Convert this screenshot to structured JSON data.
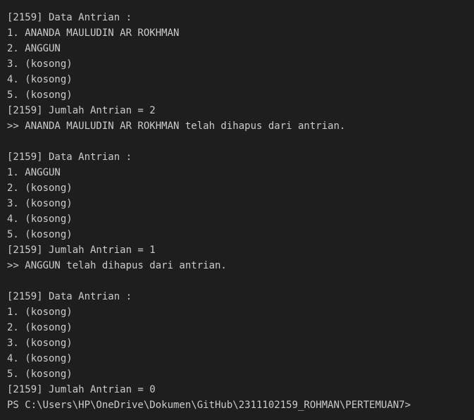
{
  "terminal": {
    "lines": [
      "[2159] Data Antrian :",
      "1. ANANDA MAULUDIN AR ROKHMAN",
      "2. ANGGUN",
      "3. (kosong)",
      "4. (kosong)",
      "5. (kosong)",
      "[2159] Jumlah Antrian = 2",
      ">> ANANDA MAULUDIN AR ROKHMAN telah dihapus dari antrian.",
      "",
      "[2159] Data Antrian :",
      "1. ANGGUN",
      "2. (kosong)",
      "3. (kosong)",
      "4. (kosong)",
      "5. (kosong)",
      "[2159] Jumlah Antrian = 1",
      ">> ANGGUN telah dihapus dari antrian.",
      "",
      "[2159] Data Antrian :",
      "1. (kosong)",
      "2. (kosong)",
      "3. (kosong)",
      "4. (kosong)",
      "5. (kosong)",
      "[2159] Jumlah Antrian = 0",
      "PS C:\\Users\\HP\\OneDrive\\Dokumen\\GitHub\\2311102159_ROHMAN\\PERTEMUAN7>"
    ]
  },
  "colors": {
    "background": "#1e1e1e",
    "text": "#cccccc"
  }
}
